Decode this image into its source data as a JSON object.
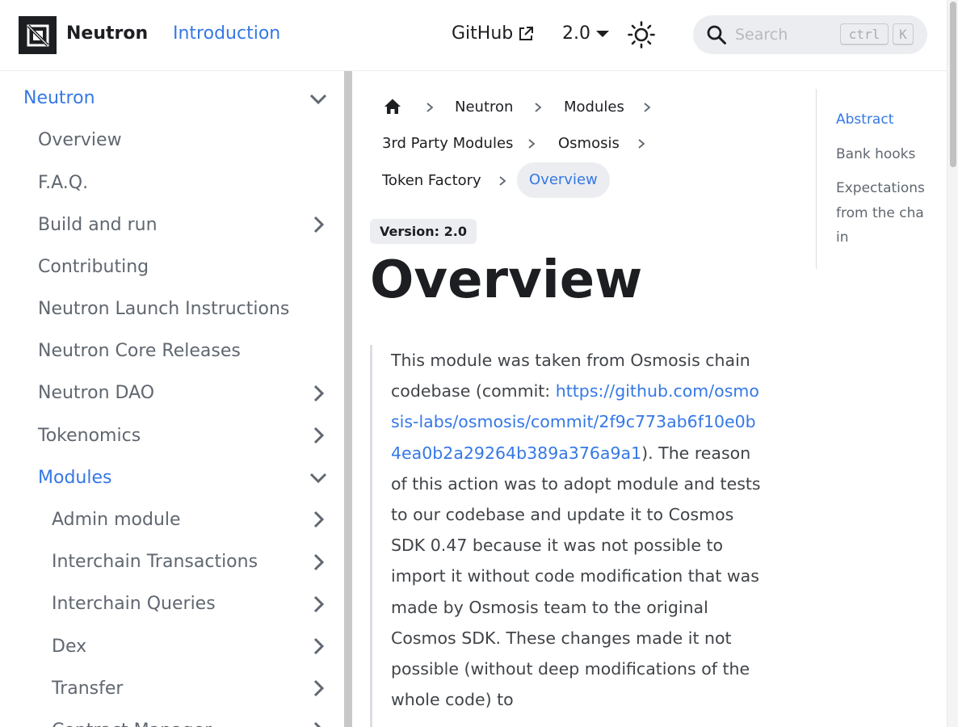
{
  "navbar": {
    "brand": "Neutron",
    "intro_link": "Introduction",
    "github_link": "GitHub",
    "version": "2.0",
    "search": {
      "placeholder": "Search",
      "kbd_ctrl": "ctrl",
      "kbd_k": "K"
    }
  },
  "sidebar": {
    "items": [
      {
        "label": "Neutron",
        "expanded": true
      },
      {
        "label": "Overview"
      },
      {
        "label": "F.A.Q."
      },
      {
        "label": "Build and run",
        "expandable": true
      },
      {
        "label": "Contributing"
      },
      {
        "label": "Neutron Launch Instructions"
      },
      {
        "label": "Neutron Core Releases"
      },
      {
        "label": "Neutron DAO",
        "expandable": true
      },
      {
        "label": "Tokenomics",
        "expandable": true
      },
      {
        "label": "Modules",
        "expanded": true
      },
      {
        "label": "Admin module",
        "expandable": true
      },
      {
        "label": "Interchain Transactions",
        "expandable": true
      },
      {
        "label": "Interchain Queries",
        "expandable": true
      },
      {
        "label": "Dex",
        "expandable": true
      },
      {
        "label": "Transfer",
        "expandable": true
      },
      {
        "label": "Contract Manager",
        "expandable": true
      }
    ]
  },
  "breadcrumbs": {
    "items": [
      "Neutron",
      "Modules",
      "3rd Party Modules",
      "Osmosis",
      "Token Factory"
    ],
    "current": "Overview"
  },
  "main": {
    "version_badge": "Version: 2.0",
    "title": "Overview",
    "quote": {
      "text_before": "This module was taken from Osmosis chain codebase (commit: ",
      "link": "https://github.com/osmosis-labs/osmosis/commit/2f9c773ab6f10e0b4ea0b2a29264b389a376a9a1",
      "text_after": "). The reason of this action was to adopt module and tests to our codebase and update it to Cosmos SDK 0.47 because it was not possible to import it without code modification that was made by Osmosis team to the original Cosmos SDK. These changes made it not possible (without deep modifications of the whole code) to"
    }
  },
  "toc": {
    "items": [
      "Abstract",
      "Bank hooks",
      "Expectations from the chain"
    ]
  },
  "colors": {
    "accent": "#3578e5",
    "text": "#1c1e21",
    "muted": "#606770",
    "badge_bg": "#ebedf0"
  }
}
